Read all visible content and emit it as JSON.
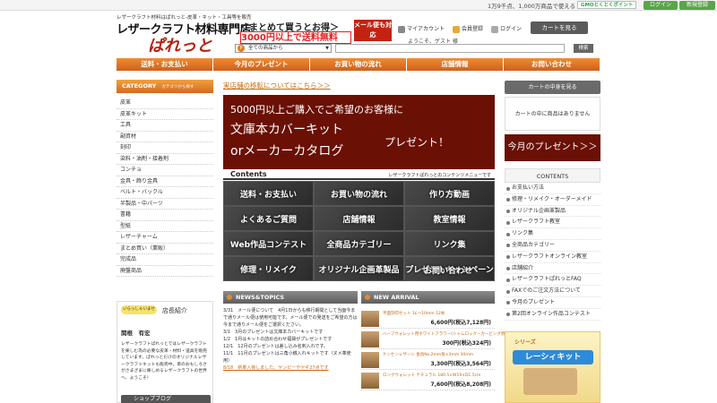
{
  "topbar": {
    "message": "1万9千点、1,000万商品で使える",
    "gmo_label": "GMOとくとくポイント",
    "login_label": "ログイン",
    "register_label": "新規登録"
  },
  "header": {
    "tagline": "レザークラフト材料はぱれっと-皮革・キット・工具等を販売",
    "logo_line1": "レザークラフト材料専門店",
    "logo_line2": "ぱれっと",
    "banner_line1": "＜まとめて買うとお得＞",
    "banner_line2": "3000円以上で送料無料",
    "mail_badge": "メール便も対応",
    "my_account": "マイアカウント",
    "member_register": "会員登録",
    "login": "ログイン",
    "cart_button": "カートを見る",
    "welcome": "ようこそ、ゲスト 様",
    "search_select": "全ての商品から",
    "search_button": "検索"
  },
  "nav": [
    "送料・お支払い",
    "今月のプレゼント",
    "お買い物の流れ",
    "店舗情報",
    "お問い合わせ"
  ],
  "sidebar": {
    "category_title": "CATEGORY",
    "category_sub": "カテゴリから探す",
    "categories": [
      "皮革",
      "皮革キット",
      "工具",
      "副資材",
      "刻印",
      "染料・油剤・接着剤",
      "コンチョ",
      "金具・飾り金具",
      "ベルト・バックル",
      "半製品・中パーツ",
      "書籍",
      "型紙",
      "レザーチャーム",
      "まとめ買い（業販）",
      "完成品",
      "廃盤商品"
    ],
    "owner_tag": "いらっしゃいませ",
    "owner_title": "店長紹介",
    "owner_name": "関根　有宏",
    "owner_bio": "レザークラフトぱれっとではレザークラフトを楽しむ為の必要な皮革・材料・道具を販売しています。ぱれっとだけのオリジナルレザークラフトキットも販売中。革のおもしろさがさまざまに楽しめるレザークラフトの世界へ、ようこそ！",
    "shop_blog": "ショップブログ"
  },
  "main": {
    "move_link": "実店舗の移転についてはこちら＞＞",
    "promo_line1": "5000円以上ご購入でご希望のお客様に",
    "promo_line2": "文庫本カバーキット",
    "promo_line3": "orメーカーカタログ",
    "promo_line4": "プレゼント！",
    "contents_title": "Contents",
    "contents_sub": "レザークラフトぱれっとのコンテンツメニューです",
    "menu": [
      "送料・お支払い",
      "お買い物の流れ",
      "作り方動画",
      "よくあるご質問",
      "店舗情報",
      "教室情報",
      "Web作品コンテスト",
      "全商品カテゴリー",
      "リンク集",
      "修理・リメイク",
      "オリジナル企画革製品",
      "プレゼントキャンペーン"
    ],
    "menu_last": "お問い合わせ",
    "news_title": "NEWS&TOPICS",
    "news": [
      "3/31　メール便について　4月1日からも移行期間として当面今まで通りメール便は使用可能です。メール便での発送をご希望の方は今まで通りメール便をご選択ください。",
      "3/1　3月のプレゼントは文庫本カバーキットです",
      "1/2　1月はキットの詰め合わせ福袋がプレゼントです",
      "12/1　12月のプレゼントは差し込み名刺入れです。",
      "11/1　11月のプレゼントは三角小銭入れキットです（ヌメ革使用）",
      "8/18　新革入荷しました。ヤンピーやヤギ27点です"
    ],
    "arrival_title": "NEW ARRIVAL",
    "arrivals": [
      {
        "name": "平面刻印セット 1£～10mm 12本",
        "price": "6,600円(税込7,128円)"
      },
      {
        "name": "ハーフウォレット用ホワイトフラワー(シャムロック・カービング原寸)",
        "price": "300円(税込324円)"
      },
      {
        "name": "ケンセンレザーシ 金具No.2mm角×3mm 30mm",
        "price": "3,300円(税込3,564円)"
      },
      {
        "name": "ロングウォレット ナチュラル 180.5×W19×D1.5cm",
        "price": "7,600円(税込8,208円)"
      }
    ]
  },
  "rightbar": {
    "cart_button": "カートの中身を見る",
    "cart_empty": "カートの中に商品はありません",
    "present_box": "今月のプレゼント＞＞",
    "contents_title": "CONTENTS",
    "contents": [
      "お支払い方法",
      "修理・リメイク・オーダーメイド",
      "オリジナル企画革製品",
      "レザークラフト教室",
      "リンク集",
      "全商品カテゴリー",
      "レザークラフトオンライン教室",
      "店舗紹介",
      "レザークラフトぱれっとFAQ",
      "FAXでのご注文方法について",
      "今月のプレゼント",
      "第2回オンライン作品コンテスト"
    ],
    "banner_top": "シリーズ",
    "banner_main": "レーシィキット"
  },
  "colors": {
    "accent": "#e07a28",
    "brand_red": "#6a1005",
    "green": "#5aa54a"
  }
}
